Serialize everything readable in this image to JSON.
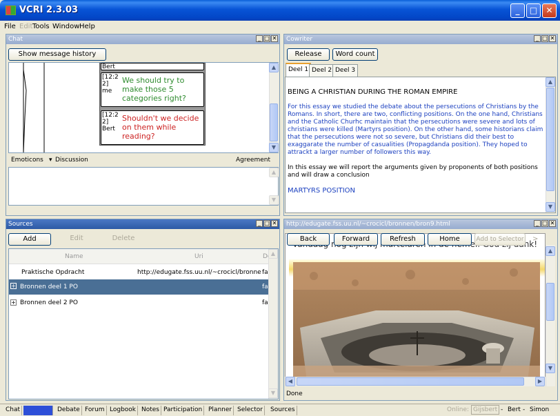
{
  "window": {
    "title": "VCRI 2.3.03",
    "minimize": "_",
    "maximize": "□",
    "close": "✕"
  },
  "menu": [
    "File",
    "Edit",
    "Tools",
    "Window",
    "Help"
  ],
  "chat": {
    "title": "Chat",
    "show_history": "Show message history",
    "messages": [
      {
        "time": "",
        "sender": "Bert",
        "text": "",
        "color": "#000000"
      },
      {
        "time": "[12:2 2] me",
        "sender": "",
        "text": "We should try to make those 5 categories right?",
        "color": "#2e8b2e"
      },
      {
        "time": "[12:2 2] Bert",
        "sender": "",
        "text": "Shouldn't we decide on them while reading?",
        "color": "#cc2222"
      }
    ],
    "emoticons": "Emoticons",
    "discussion": "Discussion",
    "agreement": "Agreement"
  },
  "cowriter": {
    "title": "Cowriter",
    "release": "Release",
    "word_count": "Word count",
    "tabs": [
      "Deel 1",
      "Deel 2",
      "Deel 3"
    ],
    "heading": "BEING A CHRISTIAN DURING THE ROMAN EMPIRE",
    "para1": "For this essay we studied the debate about the persecutions of Christians by the Romans. In short, there are two, conflicting positions. On the one hand, Christians and the Catholic Churhc maintain that the persecutions were severe and lots of christians were killed (Martyrs position). On the other hand, some historians claim that the persecutions were not so severe, but Christians did their best to exaggarate the number of casualities (Propagdanda position). They hoped to attrackt a larger number of followers this way.",
    "para2": "In this essay we will report the arguments given by proponents of both positions and will draw a conclusion",
    "martyrs": "MARTYRS POSITION"
  },
  "sources": {
    "title": "Sources",
    "add": "Add",
    "edit": "Edit",
    "delete": "Delete",
    "columns": [
      "Name",
      "Uri",
      "De"
    ],
    "rows": [
      {
        "name": "Praktische Opdracht",
        "uri": "http://edugate.fss.uu.nl/~crocicl/bronne",
        "de": "fa"
      },
      {
        "name": "Bronnen deel 1 PO",
        "uri": "",
        "de": "fa"
      },
      {
        "name": "Bronnen deel 2 PO",
        "uri": "",
        "de": "fa"
      }
    ]
  },
  "browser": {
    "title": "http://edugate.fss.uu.nl/~crocicl/bronnen/bron9.html",
    "back": "Back",
    "forward": "Forward",
    "refresh": "Refresh",
    "home": "Home",
    "add_selector": "Add to Selector",
    "more": ">",
    "page_text": "Vandaag nog zijn wij martelaren in de hemel. God zij dank!",
    "status": "Done"
  },
  "taskbar": {
    "tabs": [
      "Chat",
      "Cowriter",
      "Debate",
      "Forum",
      "Logbook",
      "Notes",
      "Participation",
      "Planner",
      "Selector",
      "Sources"
    ],
    "online_label": "Online:",
    "users": [
      "Gijsbert",
      "Bert",
      "Simon"
    ],
    "sep": "-"
  }
}
